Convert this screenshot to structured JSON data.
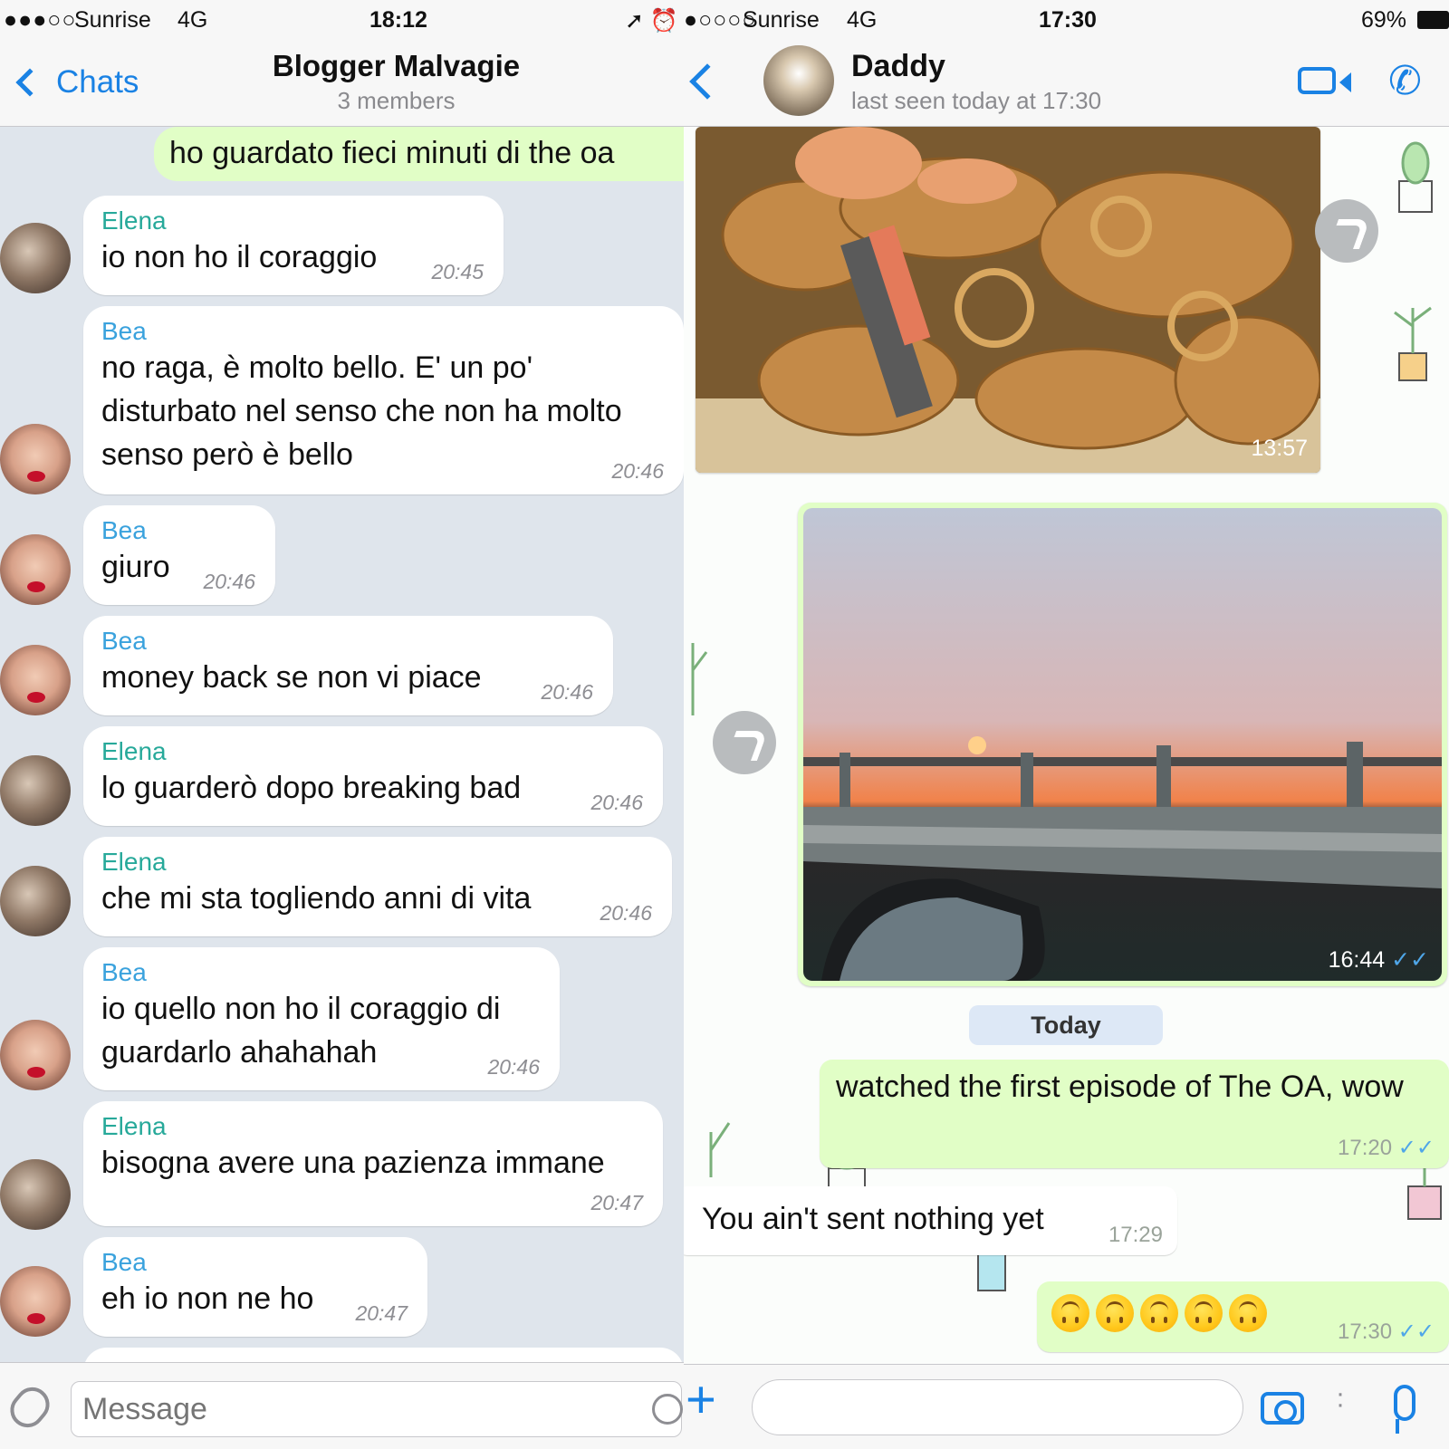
{
  "left": {
    "status": {
      "signal": "●●●○○",
      "carrier": "Sunrise",
      "network": "4G",
      "time": "18:12",
      "icons": "➚ ⏰"
    },
    "nav": {
      "back_label": "Chats",
      "title": "Blogger Malvagie",
      "subtitle": "3 members"
    },
    "outgoing_partial": "ho guardato fieci minuti di the oa",
    "messages": [
      {
        "sender": "Elena",
        "text": "io non ho il coraggio",
        "time": "20:45"
      },
      {
        "sender": "Bea",
        "text": "no raga, è molto bello. E' un po' disturbato nel senso che non ha molto senso però è bello",
        "time": "20:46"
      },
      {
        "sender": "Bea",
        "text": "giuro",
        "time": "20:46"
      },
      {
        "sender": "Bea",
        "text": "money back se non vi piace",
        "time": "20:46"
      },
      {
        "sender": "Elena",
        "text": "lo guarderò dopo breaking bad",
        "time": "20:46"
      },
      {
        "sender": "Elena",
        "text": "che mi sta togliendo anni di vita",
        "time": "20:46"
      },
      {
        "sender": "Bea",
        "text": "io quello non ho il coraggio di guardarlo ahahahah",
        "time": "20:46"
      },
      {
        "sender": "Elena",
        "text": "bisogna avere una pazienza immane",
        "time": "20:47"
      },
      {
        "sender": "Bea",
        "text": "eh io non ne ho",
        "time": "20:47"
      }
    ],
    "input": {
      "placeholder": "Message"
    }
  },
  "right": {
    "status": {
      "signal": "●○○○○",
      "carrier": "Sunrise",
      "network": "4G",
      "time": "17:30",
      "battery": "69%"
    },
    "nav": {
      "contact_name": "Daddy",
      "last_seen": "last seen today at 17:30"
    },
    "images": [
      {
        "subject": "fried seafood platter",
        "time": "13:57"
      },
      {
        "subject": "sunset from car window",
        "time": "16:44",
        "ticks": "✓✓"
      }
    ],
    "date_separator": "Today",
    "messages": [
      {
        "direction": "out",
        "text": "watched the first episode of The OA, wow",
        "time": "17:20",
        "ticks": "✓✓"
      },
      {
        "direction": "in",
        "text": "You ain't sent nothing yet",
        "time": "17:29"
      },
      {
        "direction": "out",
        "emoji": "upside-down-face",
        "emoji_count": 5,
        "time": "17:30",
        "ticks": "✓✓"
      }
    ],
    "colors": {
      "outgoing": "#e1fec6",
      "accent": "#1a82e4",
      "read_ticks": "#4fa6e8"
    }
  }
}
